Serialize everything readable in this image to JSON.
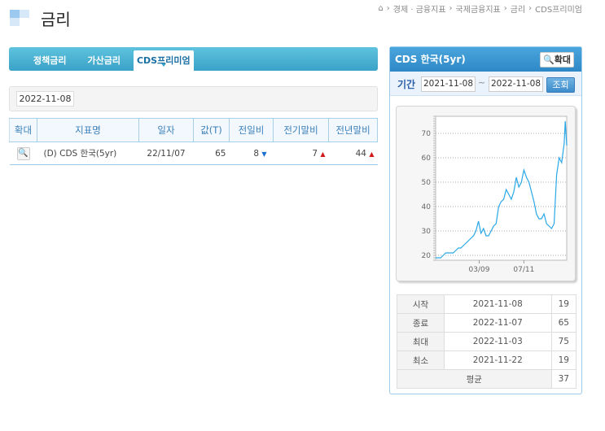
{
  "header": {
    "title": "금리",
    "breadcrumb": [
      "경제 · 금융지표",
      "국제금융지표",
      "금리",
      "CDS프리미엄"
    ]
  },
  "tabs": [
    {
      "label": "정책금리"
    },
    {
      "label": "가산금리"
    },
    {
      "label": "CDS프리미엄",
      "active": true
    }
  ],
  "date_filter": "2022-11-08",
  "table": {
    "headers": [
      "확대",
      "지표명",
      "일자",
      "값(T)",
      "전일비",
      "전기말비",
      "전년말비"
    ],
    "rows": [
      {
        "name": "(D) CDS 한국(5yr)",
        "date": "22/11/07",
        "value": "65",
        "day_change": "8",
        "day_dir": "down",
        "period_change": "7",
        "period_dir": "up",
        "year_change": "44",
        "year_dir": "up"
      }
    ]
  },
  "side": {
    "title": "CDS 한국(5yr)",
    "zoom_label": "🔍확대",
    "period_label": "기간",
    "from": "2021-11-08",
    "tilde": "~",
    "to": "2022-11-08",
    "query_label": "조회",
    "stats": [
      {
        "label": "시작",
        "date": "2021-11-08",
        "value": "19"
      },
      {
        "label": "종료",
        "date": "2022-11-07",
        "value": "65"
      },
      {
        "label": "최대",
        "date": "2022-11-03",
        "value": "75"
      },
      {
        "label": "최소",
        "date": "2021-11-22",
        "value": "19"
      }
    ],
    "avg_label": "평균",
    "avg_value": "37"
  },
  "chart_data": {
    "type": "line",
    "ylim": [
      18,
      77
    ],
    "yticks": [
      20,
      30,
      40,
      50,
      60,
      70
    ],
    "xlim": [
      0,
      364
    ],
    "xticks": [
      {
        "day": 121,
        "label": "03/09"
      },
      {
        "day": 245,
        "label": "07/11"
      }
    ],
    "x_unit": "days since 2021-11-08",
    "x": [
      0,
      7,
      14,
      21,
      28,
      35,
      42,
      49,
      56,
      63,
      70,
      77,
      84,
      91,
      98,
      105,
      112,
      119,
      126,
      133,
      140,
      147,
      154,
      161,
      168,
      175,
      182,
      189,
      196,
      203,
      210,
      217,
      224,
      231,
      238,
      245,
      252,
      259,
      266,
      273,
      280,
      287,
      294,
      301,
      308,
      315,
      322,
      329,
      336,
      343,
      350,
      357,
      360,
      364
    ],
    "values": [
      19,
      19,
      19,
      20,
      21,
      21,
      21,
      21,
      22,
      23,
      23,
      24,
      25,
      26,
      27,
      28,
      30,
      34,
      29,
      31,
      28,
      28,
      30,
      32,
      33,
      40,
      42,
      43,
      47,
      45,
      43,
      46,
      52,
      48,
      50,
      55,
      52,
      50,
      46,
      42,
      37,
      35,
      35,
      37,
      33,
      32,
      31,
      33,
      53,
      60,
      58,
      66,
      75,
      65
    ],
    "color": "#29a8e8"
  }
}
